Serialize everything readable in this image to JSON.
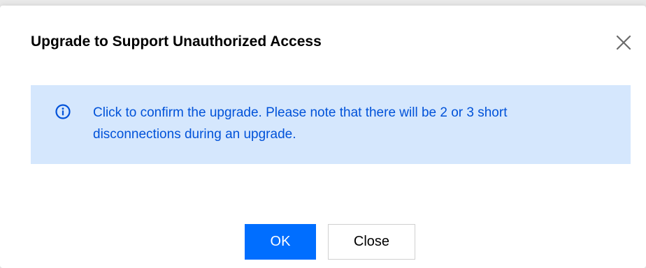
{
  "dialog": {
    "title": "Upgrade to Support Unauthorized Access",
    "close_icon": "close-icon",
    "notice": {
      "icon": "info-icon",
      "text": "Click to confirm the upgrade. Please note that there will be 2 or 3 short disconnections during an upgrade."
    },
    "buttons": {
      "ok_label": "OK",
      "close_label": "Close"
    }
  },
  "colors": {
    "primary": "#006eff",
    "notice_background": "#d5e7fd",
    "notice_text": "#0052d9"
  }
}
